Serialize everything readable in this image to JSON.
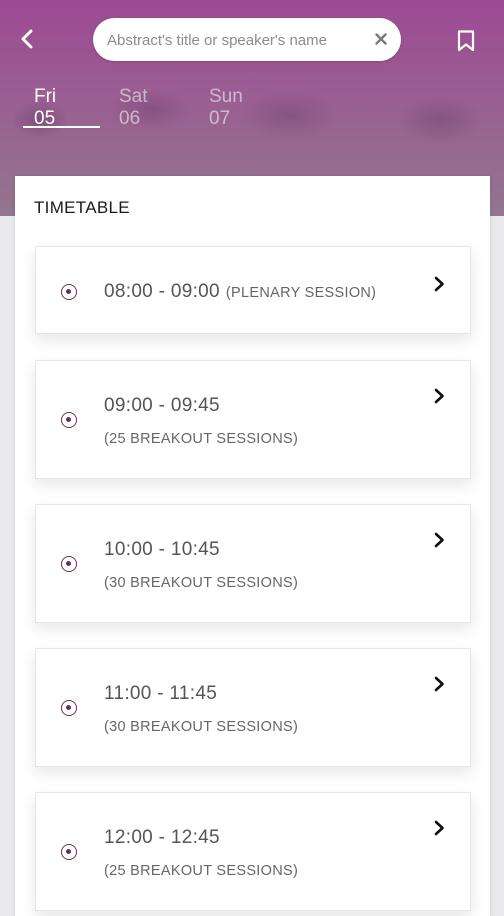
{
  "header": {
    "search": {
      "placeholder": "Abstract's title or speaker's name",
      "value": ""
    },
    "icons": {
      "back": "chevron-left-icon",
      "clear": "close-icon",
      "bookmark": "bookmark-icon"
    }
  },
  "tabs": [
    {
      "label": "Fri 05",
      "active": true
    },
    {
      "label": "Sat 06",
      "active": false
    },
    {
      "label": "Sun 07",
      "active": false
    }
  ],
  "timetable": {
    "title": "TIMETABLE",
    "slots": [
      {
        "time": "08:00 - 09:00",
        "detail": "(PLENARY SESSION)"
      },
      {
        "time": "09:00 - 09:45",
        "detail": "(25 BREAKOUT SESSIONS)"
      },
      {
        "time": "10:00 - 10:45",
        "detail": "(30 BREAKOUT SESSIONS)"
      },
      {
        "time": "11:00 - 11:45",
        "detail": "(30 BREAKOUT SESSIONS)"
      },
      {
        "time": "12:00 - 12:45",
        "detail": "(25 BREAKOUT SESSIONS)"
      }
    ]
  },
  "colors": {
    "accent": "#6b2f61",
    "header": "#963c8c"
  }
}
